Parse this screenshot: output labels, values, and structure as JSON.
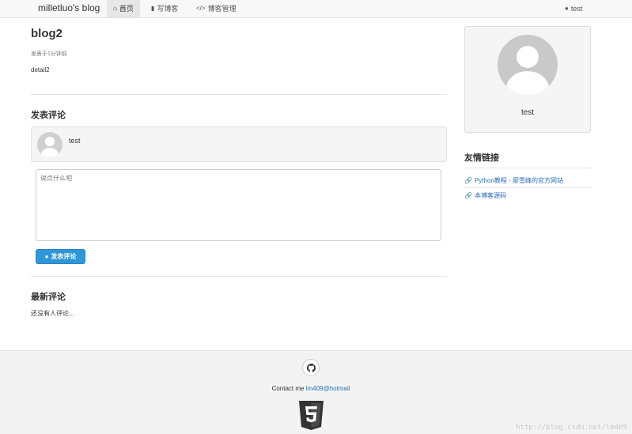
{
  "navbar": {
    "brand": "milletluo's blog",
    "items": [
      {
        "label": "首页",
        "icon": "home-icon",
        "active": true
      },
      {
        "label": "写博客",
        "icon": "book-icon",
        "active": false
      },
      {
        "label": "博客管理",
        "icon": "code-icon",
        "active": false
      }
    ],
    "user": {
      "label": "test",
      "icon": "user-icon"
    }
  },
  "post": {
    "title": "blog2",
    "meta": "发表于1分钟前",
    "body": "detail2"
  },
  "comment_form": {
    "heading": "发表评论",
    "username": "test",
    "placeholder": "说点什么吧",
    "submit_label": "发表评论",
    "submit_icon": "comment-icon"
  },
  "latest": {
    "heading": "最新评论",
    "empty_text": "还没有人评论..."
  },
  "sidebar": {
    "profile_name": "test",
    "links_heading": "友情链接",
    "links": [
      {
        "label": "Python教程 - 廖雪峰的官方网站",
        "icon": "link-icon"
      },
      {
        "label": "本博客源码",
        "icon": "link-icon"
      }
    ]
  },
  "footer": {
    "contact_prefix": "Contact me ",
    "email": "lm409@hotmail",
    "github_icon": "github-icon",
    "logo_icon": "html5-logo-icon",
    "watermark": "http://blog.csdn.net/lm409"
  },
  "colors": {
    "accent": "#2f96d8",
    "link": "#2a6ebb"
  }
}
